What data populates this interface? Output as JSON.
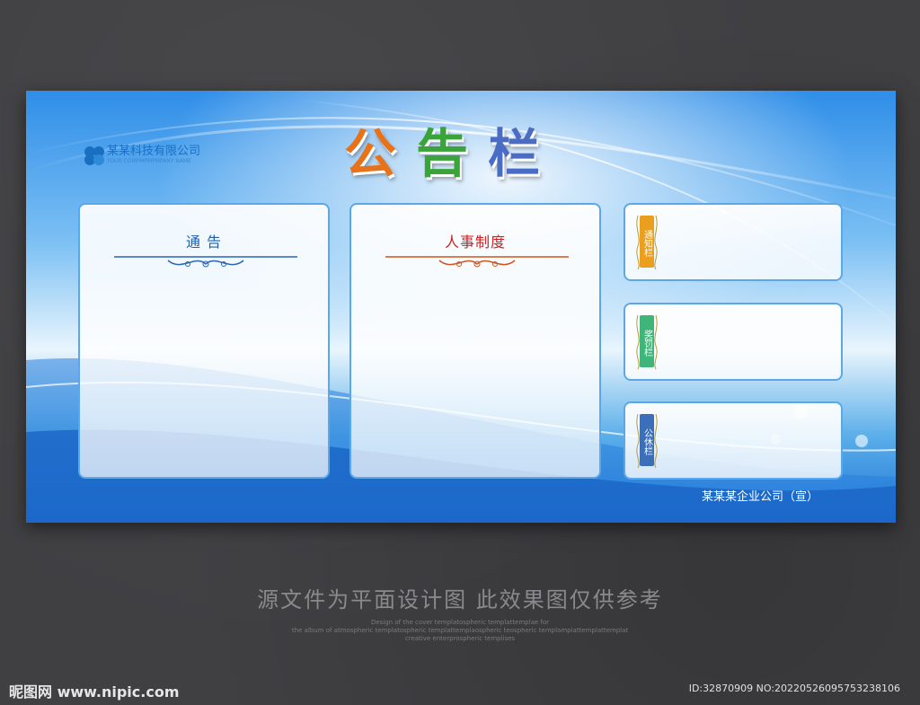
{
  "board": {
    "title": [
      "公",
      "告",
      "栏"
    ],
    "logo": {
      "name": "某某科技有限公司",
      "sub": "YOUR COMPMPMPMPANY NAME"
    },
    "panels": [
      {
        "heading": "通 告"
      },
      {
        "heading": "人事制度"
      }
    ],
    "side_tags": [
      "通知栏",
      "奖罚栏",
      "公休栏"
    ],
    "company": "某某某企业公司（宣）"
  },
  "caption": "源文件为平面设计图 此效果图仅供参考",
  "fine_print": [
    "Design of the cover templatospheric templattemplae for",
    "the album of atmospheric templatospheric templattemplaospheric teospheric templampiattemplattemplat",
    "creative enterprospheric templises"
  ],
  "watermark": {
    "site": "昵图网 www.nipic.com",
    "id": "ID:32870909 NO:20220526095753238106"
  },
  "colors": {
    "frame": "#5aa8ea",
    "tag_orange": "#eaa01e",
    "tag_green": "#3fb57a",
    "tag_blue": "#3c6fb7"
  }
}
